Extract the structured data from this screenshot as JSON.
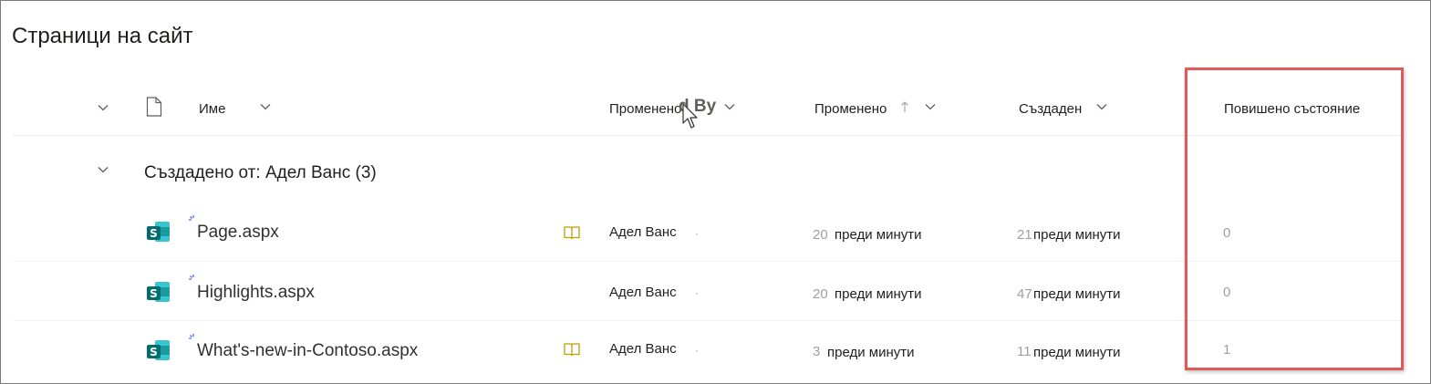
{
  "page": {
    "title": "Страници на сайт"
  },
  "columns": {
    "name": "Име",
    "modified_by": "Променено",
    "modified_by_overlay": "d By",
    "modified": "Променено",
    "created": "Създаден",
    "promoted_state": "Повишено състояние"
  },
  "group": {
    "label": "Създадено от: Адел Ванс (3)"
  },
  "rows": [
    {
      "name": "Page.aspx",
      "modified_by": "Адел Ванс",
      "modified_num": "20",
      "modified_unit": "преди минути",
      "created_num": "21",
      "created_unit": "преди минути",
      "promoted": "0"
    },
    {
      "name": "Highlights.aspx",
      "modified_by": "Адел Ванс",
      "modified_num": "20",
      "modified_unit": "преди минути",
      "created_num": "47",
      "created_unit": "преди минути",
      "promoted": "0"
    },
    {
      "name": "What's-new-in-Contoso.aspx",
      "modified_by": "Адел Ванс",
      "modified_num": "3",
      "modified_unit": "преди минути",
      "created_num": "11",
      "created_unit": "преди минути",
      "promoted": "1"
    }
  ],
  "colors": {
    "sharepoint_teal": "#036C70",
    "highlight_red": "#E05A5A",
    "new_mark_blue": "#4F6BED",
    "book_gold": "#C19C00"
  }
}
